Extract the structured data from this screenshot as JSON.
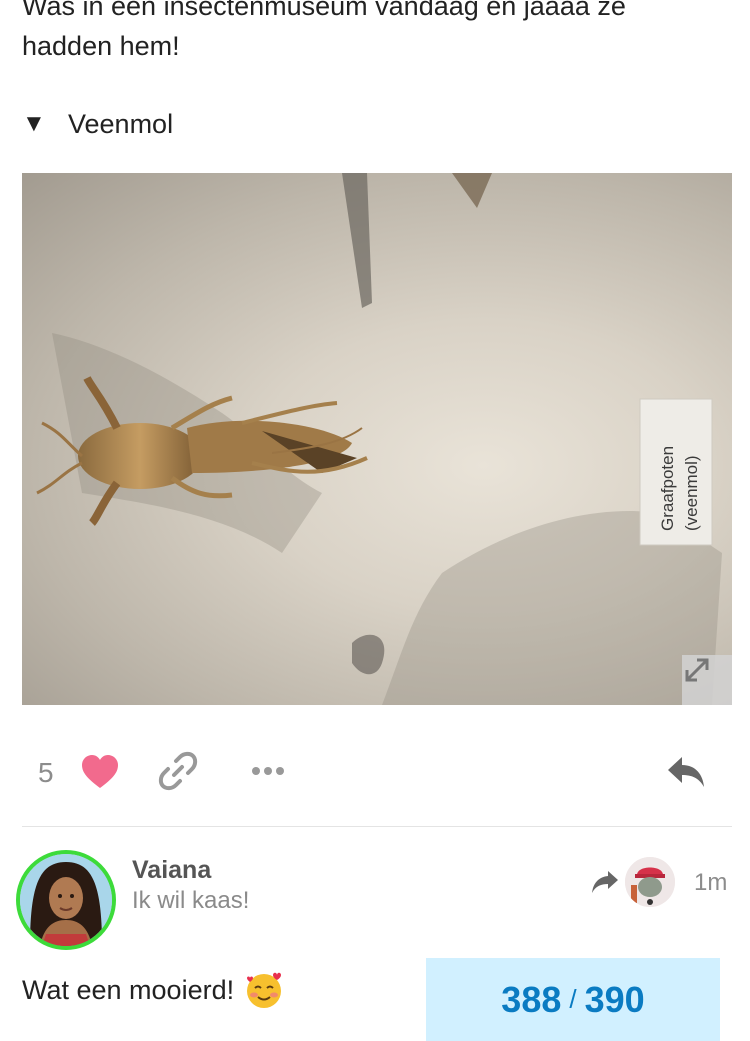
{
  "post": {
    "text": "Was in een insectenmuseum vandaag en jaaaa ze hadden hem!",
    "details_summary": "Veenmol",
    "image": {
      "label_line1": "Graafpoten",
      "label_line2": "(veenmol)"
    },
    "like_count": "5"
  },
  "reply": {
    "username": "Vaiana",
    "user_title": "Ik wil kaas!",
    "age": "1m",
    "text": "Wat een mooierd!",
    "emoji": "smiling-face-with-hearts"
  },
  "progress": {
    "current": "388",
    "separator": "/",
    "total": "390"
  },
  "colors": {
    "heart": "#f26a8d",
    "icon_gray": "#999999",
    "accent": "#0a7bc2",
    "progress_bg": "#d1f0ff",
    "avatar_ring": "#3ddb3a"
  },
  "icons": {
    "disclosure": "triangle-down-icon",
    "expand": "expand-icon",
    "heart": "heart-icon",
    "link": "link-icon",
    "more": "ellipsis-icon",
    "reply": "reply-icon",
    "reply_to": "share-arrow-icon"
  }
}
